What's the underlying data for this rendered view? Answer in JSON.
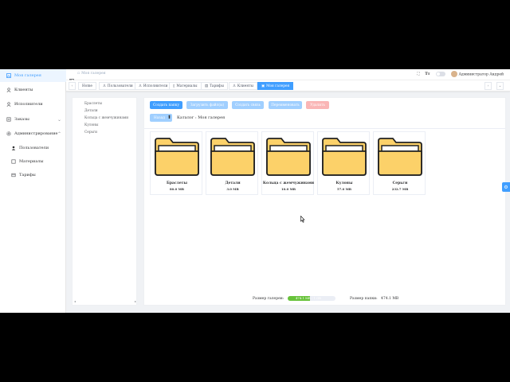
{
  "sidebar": {
    "items": [
      {
        "label": "Моя галерея",
        "icon": "gallery-icon"
      },
      {
        "label": "Клиенты",
        "icon": "user-icon"
      },
      {
        "label": "Исполнители",
        "icon": "user-icon"
      },
      {
        "label": "Заказы",
        "icon": "order-icon"
      },
      {
        "label": "Администрирование",
        "icon": "settings-icon"
      },
      {
        "label": "Пользователи",
        "icon": "users-icon"
      },
      {
        "label": "Материалы",
        "icon": "materials-icon"
      },
      {
        "label": "Тарифы",
        "icon": "tariff-icon"
      }
    ]
  },
  "header": {
    "breadcrumb": "Моя галерея",
    "user_name": "Администратор Андрей",
    "font_size_label": "Tт"
  },
  "tags": [
    {
      "label": "Home"
    },
    {
      "label": "Пользователи"
    },
    {
      "label": "Исполнители"
    },
    {
      "label": "Материалы"
    },
    {
      "label": "Тарифы"
    },
    {
      "label": "Клиенты"
    },
    {
      "label": "Моя галерея"
    }
  ],
  "tree": {
    "items": [
      "Браслеты",
      "Детали",
      "Кольца с жемчужинами",
      "Кулоны",
      "Серьги"
    ]
  },
  "toolbar": {
    "create_folder": "Создать папку",
    "upload_files": "Загрузить файл(ы)",
    "create_link": "Создать связь",
    "rename": "Переименовать",
    "delete": "Удалить",
    "back": "Назад"
  },
  "catalog_label": "Каталог : Моя галерея",
  "folders": [
    {
      "name": "Браслеты",
      "size": "80.0 MB"
    },
    {
      "name": "Детали",
      "size": "3.0 MB"
    },
    {
      "name": "Кольца с жемчужинами",
      "size": "10.0 MB"
    },
    {
      "name": "Кулоны",
      "size": "57.0 MB"
    },
    {
      "name": "Серьги",
      "size": "232.7 MB"
    }
  ],
  "footer": {
    "gallery_size_label": "Размер галереи:",
    "progress_text": "474.1 MB / 1 GB",
    "progress_fraction": 0.46,
    "folder_size_label": "Размер папки:",
    "folder_size_value": "474.1 MB"
  },
  "colors": {
    "accent": "#409eff",
    "success": "#67c23a",
    "folder": "#fcd169"
  }
}
